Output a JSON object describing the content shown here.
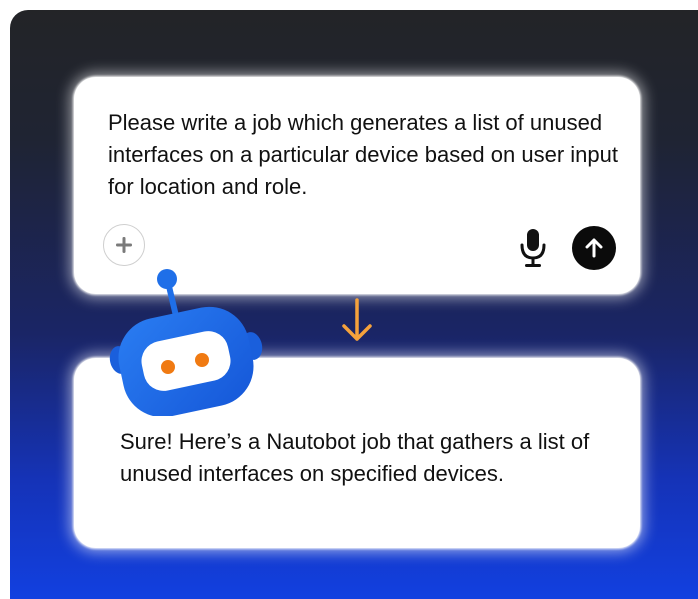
{
  "prompt": {
    "text": "Please write a job which generates a list of unused interfaces on a particular device based on user input for location and role.",
    "add_icon": "plus-icon",
    "mic_icon": "microphone-icon",
    "send_icon": "arrow-up-icon"
  },
  "reply": {
    "text": "Sure! Here’s a Nautobot job that gathers a list of unused interfaces on specified devices."
  },
  "decor": {
    "connector_icon": "arrow-down-icon",
    "mascot_icon": "robot-icon"
  },
  "colors": {
    "background_top": "#232427",
    "background_bottom": "#1240e0",
    "arrow": "#f5a23c",
    "robot_body": "#1f6fe8",
    "robot_eyes": "#f07a12",
    "send_button": "#0b0b0b"
  }
}
